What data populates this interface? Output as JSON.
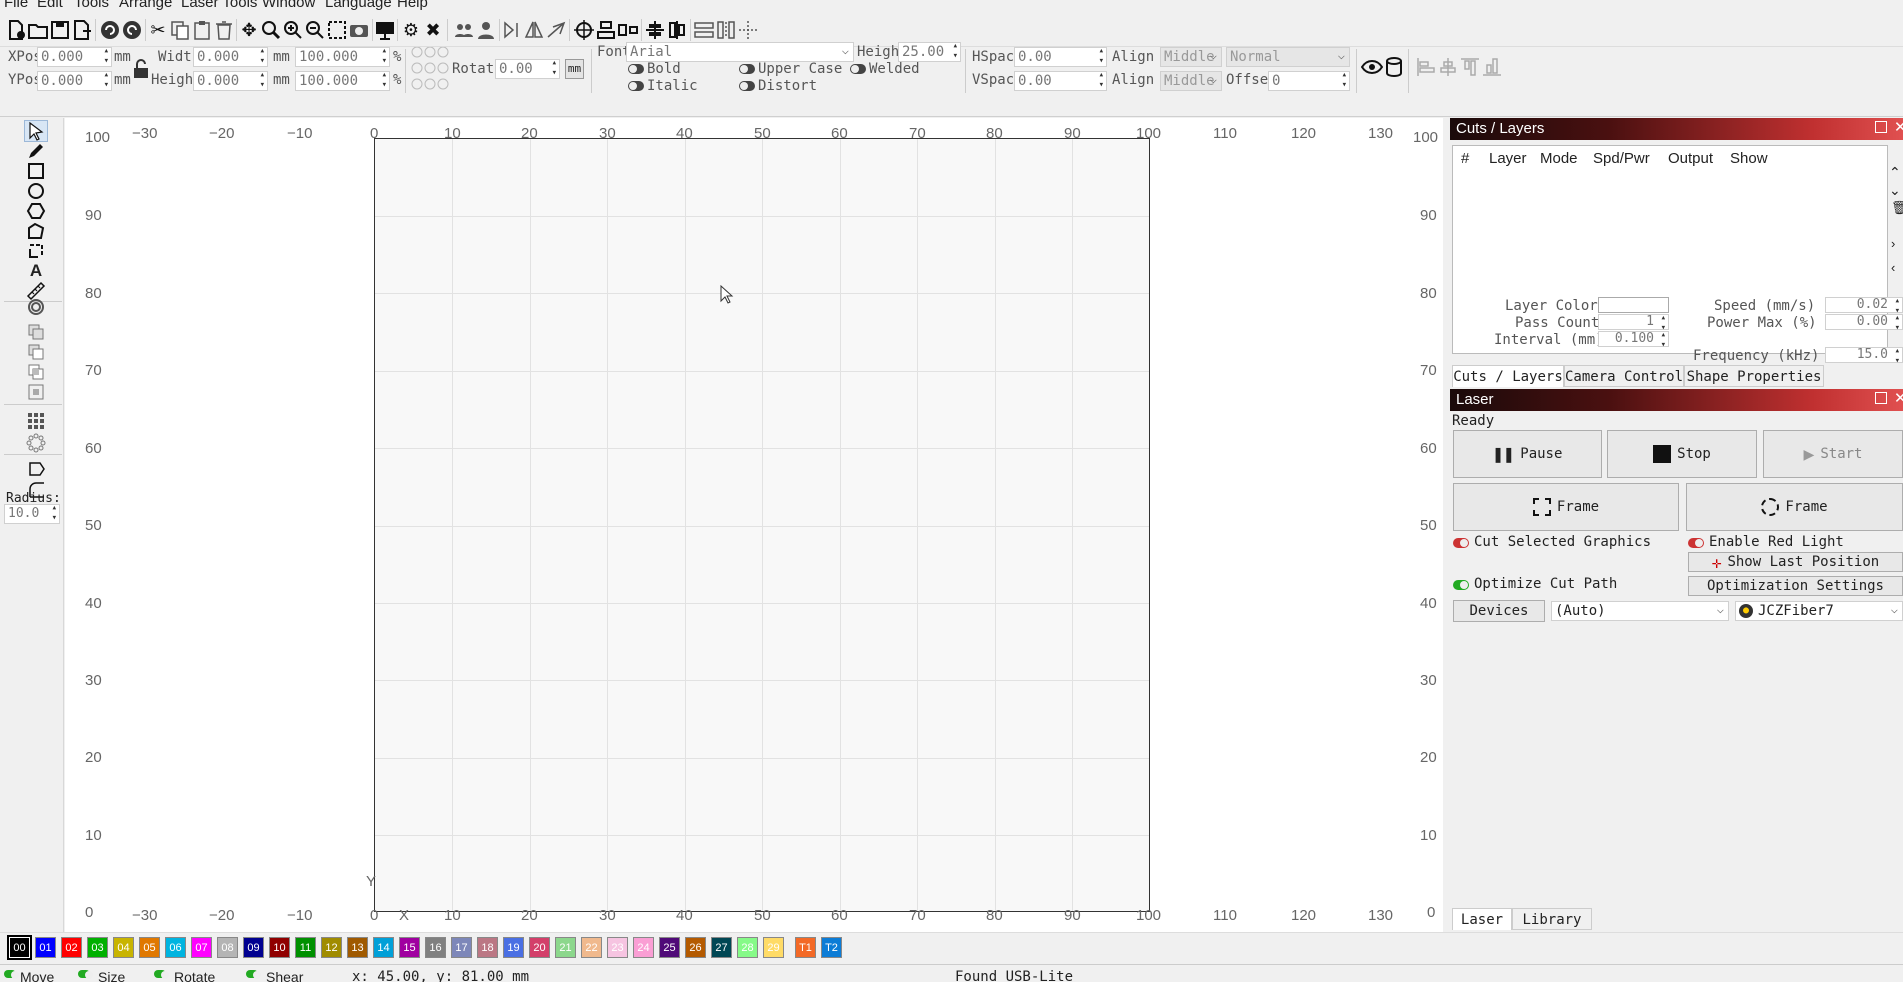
{
  "menu": [
    "File",
    "Edit",
    "Tools",
    "Arrange",
    "Laser Tools",
    "Window",
    "Language",
    "Help"
  ],
  "props": {
    "xpos_label": "XPos",
    "xpos_value": "0.000",
    "ypos_label": "YPos",
    "ypos_value": "0.000",
    "unit_mm": "mm",
    "width_label": "Width",
    "width_value": "0.000",
    "height_label": "Height",
    "height_value": "0.000",
    "scale_x": "100.000",
    "scale_y": "100.000",
    "percent": "%",
    "rotate_label": "Rotate",
    "rotate_value": "0.00",
    "mm_toggle": "mm",
    "font_label": "Font",
    "font_value": "Arial",
    "text_height_label": "Height",
    "text_height_value": "25.00",
    "bold": "Bold",
    "italic": "Italic",
    "upper_case": "Upper Case",
    "distort": "Distort",
    "welded": "Welded",
    "hspace_label": "HSpace",
    "hspace_value": "0.00",
    "vspace_label": "VSpace",
    "vspace_value": "0.00",
    "alignx_label": "Align X",
    "alignx_value": "Middle",
    "aligny_label": "Align Y",
    "aligny_value": "Middle",
    "normal_value": "Normal",
    "offset_label": "Offset",
    "offset_value": "0"
  },
  "lefttools": {
    "radius_label": "Radius:",
    "radius_value": "10.0"
  },
  "ruler": {
    "top": [
      "−30",
      "−20",
      "−10",
      "0",
      "10",
      "20",
      "30",
      "40",
      "50",
      "60",
      "70",
      "80",
      "90",
      "100",
      "110",
      "120",
      "130"
    ],
    "left": [
      "100",
      "90",
      "80",
      "70",
      "60",
      "50",
      "40",
      "30",
      "20",
      "10",
      "0"
    ],
    "axis_x": "X",
    "axis_y": "Y"
  },
  "cuts": {
    "title": "Cuts / Layers",
    "columns": [
      "#",
      "Layer",
      "Mode",
      "Spd/Pwr",
      "Output",
      "Show"
    ],
    "layer_color_label": "Layer Color",
    "speed_label": "Speed (mm/s)",
    "speed_value": "0.02",
    "pass_count_label": "Pass Count",
    "pass_count_value": "1",
    "power_max_label": "Power Max (%)",
    "power_max_value": "0.00",
    "interval_label": "Interval (mm)",
    "interval_value": "0.100",
    "frequency_label": "Frequency (kHz)",
    "frequency_value": "15.0",
    "tabs": [
      "Cuts / Layers",
      "Camera Control",
      "Shape Properties"
    ]
  },
  "laser": {
    "title": "Laser",
    "status": "Ready",
    "pause": "Pause",
    "stop": "Stop",
    "start": "Start",
    "frame1": "Frame",
    "frame2": "Frame",
    "cut_selected": "Cut Selected Graphics",
    "enable_red_light": "Enable Red Light",
    "show_last_position": "Show Last Position",
    "optimize_cut_path": "Optimize Cut Path",
    "optimization_settings": "Optimization Settings",
    "devices": "Devices",
    "port": "(Auto)",
    "device": "JCZFiber7",
    "tabs": [
      "Laser",
      "Library"
    ]
  },
  "palette": [
    {
      "label": "00",
      "color": "#000000"
    },
    {
      "label": "01",
      "color": "#0000ff"
    },
    {
      "label": "02",
      "color": "#ff0000"
    },
    {
      "label": "03",
      "color": "#00b000"
    },
    {
      "label": "04",
      "color": "#c8b400"
    },
    {
      "label": "05",
      "color": "#e07800"
    },
    {
      "label": "06",
      "color": "#00b4e0"
    },
    {
      "label": "07",
      "color": "#ff00ff"
    },
    {
      "label": "08",
      "color": "#b4b4b4"
    },
    {
      "label": "09",
      "color": "#000090"
    },
    {
      "label": "10",
      "color": "#900000"
    },
    {
      "label": "11",
      "color": "#009000"
    },
    {
      "label": "12",
      "color": "#a08c00"
    },
    {
      "label": "13",
      "color": "#a05a00"
    },
    {
      "label": "14",
      "color": "#00a0d8"
    },
    {
      "label": "15",
      "color": "#a000a0"
    },
    {
      "label": "16",
      "color": "#808080"
    },
    {
      "label": "17",
      "color": "#7d87b9"
    },
    {
      "label": "18",
      "color": "#bb7784"
    },
    {
      "label": "19",
      "color": "#4a6fe3"
    },
    {
      "label": "20",
      "color": "#d33f6a"
    },
    {
      "label": "21",
      "color": "#8cd78c"
    },
    {
      "label": "22",
      "color": "#f0b98d"
    },
    {
      "label": "23",
      "color": "#f6c4e1"
    },
    {
      "label": "24",
      "color": "#fa9ed4"
    },
    {
      "label": "25",
      "color": "#500a78"
    },
    {
      "label": "26",
      "color": "#b45a00"
    },
    {
      "label": "27",
      "color": "#004754"
    },
    {
      "label": "28",
      "color": "#86fa88"
    },
    {
      "label": "29",
      "color": "#ffdb66"
    },
    {
      "label": "T1",
      "color": "#f36926"
    },
    {
      "label": "T2",
      "color": "#0c7cd6"
    }
  ],
  "status": {
    "move": "Move",
    "size": "Size",
    "rotate": "Rotate",
    "shear": "Shear",
    "coords": "x: 45.00, y: 81.00 mm",
    "message": "Found USB-Lite"
  }
}
